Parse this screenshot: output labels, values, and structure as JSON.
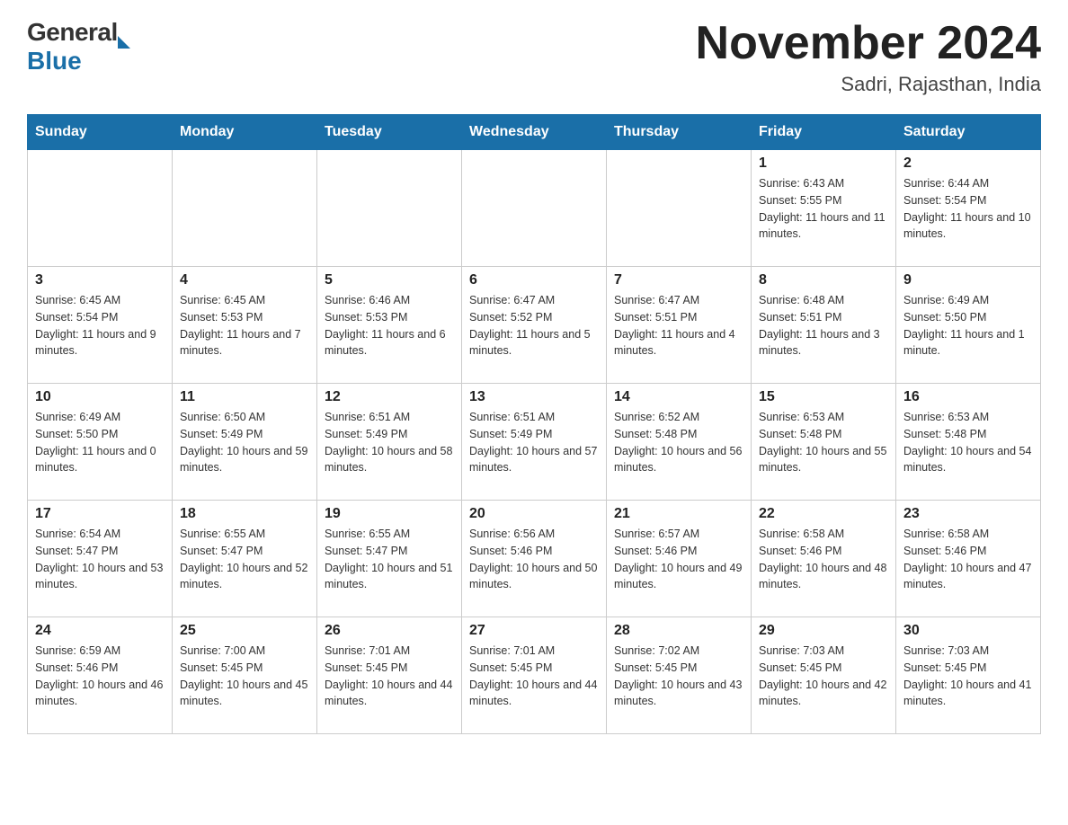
{
  "logo": {
    "general": "General",
    "arrow": "",
    "blue": "Blue"
  },
  "header": {
    "title": "November 2024",
    "subtitle": "Sadri, Rajasthan, India"
  },
  "days_of_week": [
    "Sunday",
    "Monday",
    "Tuesday",
    "Wednesday",
    "Thursday",
    "Friday",
    "Saturday"
  ],
  "weeks": [
    [
      {
        "day": "",
        "info": ""
      },
      {
        "day": "",
        "info": ""
      },
      {
        "day": "",
        "info": ""
      },
      {
        "day": "",
        "info": ""
      },
      {
        "day": "",
        "info": ""
      },
      {
        "day": "1",
        "info": "Sunrise: 6:43 AM\nSunset: 5:55 PM\nDaylight: 11 hours and 11 minutes."
      },
      {
        "day": "2",
        "info": "Sunrise: 6:44 AM\nSunset: 5:54 PM\nDaylight: 11 hours and 10 minutes."
      }
    ],
    [
      {
        "day": "3",
        "info": "Sunrise: 6:45 AM\nSunset: 5:54 PM\nDaylight: 11 hours and 9 minutes."
      },
      {
        "day": "4",
        "info": "Sunrise: 6:45 AM\nSunset: 5:53 PM\nDaylight: 11 hours and 7 minutes."
      },
      {
        "day": "5",
        "info": "Sunrise: 6:46 AM\nSunset: 5:53 PM\nDaylight: 11 hours and 6 minutes."
      },
      {
        "day": "6",
        "info": "Sunrise: 6:47 AM\nSunset: 5:52 PM\nDaylight: 11 hours and 5 minutes."
      },
      {
        "day": "7",
        "info": "Sunrise: 6:47 AM\nSunset: 5:51 PM\nDaylight: 11 hours and 4 minutes."
      },
      {
        "day": "8",
        "info": "Sunrise: 6:48 AM\nSunset: 5:51 PM\nDaylight: 11 hours and 3 minutes."
      },
      {
        "day": "9",
        "info": "Sunrise: 6:49 AM\nSunset: 5:50 PM\nDaylight: 11 hours and 1 minute."
      }
    ],
    [
      {
        "day": "10",
        "info": "Sunrise: 6:49 AM\nSunset: 5:50 PM\nDaylight: 11 hours and 0 minutes."
      },
      {
        "day": "11",
        "info": "Sunrise: 6:50 AM\nSunset: 5:49 PM\nDaylight: 10 hours and 59 minutes."
      },
      {
        "day": "12",
        "info": "Sunrise: 6:51 AM\nSunset: 5:49 PM\nDaylight: 10 hours and 58 minutes."
      },
      {
        "day": "13",
        "info": "Sunrise: 6:51 AM\nSunset: 5:49 PM\nDaylight: 10 hours and 57 minutes."
      },
      {
        "day": "14",
        "info": "Sunrise: 6:52 AM\nSunset: 5:48 PM\nDaylight: 10 hours and 56 minutes."
      },
      {
        "day": "15",
        "info": "Sunrise: 6:53 AM\nSunset: 5:48 PM\nDaylight: 10 hours and 55 minutes."
      },
      {
        "day": "16",
        "info": "Sunrise: 6:53 AM\nSunset: 5:48 PM\nDaylight: 10 hours and 54 minutes."
      }
    ],
    [
      {
        "day": "17",
        "info": "Sunrise: 6:54 AM\nSunset: 5:47 PM\nDaylight: 10 hours and 53 minutes."
      },
      {
        "day": "18",
        "info": "Sunrise: 6:55 AM\nSunset: 5:47 PM\nDaylight: 10 hours and 52 minutes."
      },
      {
        "day": "19",
        "info": "Sunrise: 6:55 AM\nSunset: 5:47 PM\nDaylight: 10 hours and 51 minutes."
      },
      {
        "day": "20",
        "info": "Sunrise: 6:56 AM\nSunset: 5:46 PM\nDaylight: 10 hours and 50 minutes."
      },
      {
        "day": "21",
        "info": "Sunrise: 6:57 AM\nSunset: 5:46 PM\nDaylight: 10 hours and 49 minutes."
      },
      {
        "day": "22",
        "info": "Sunrise: 6:58 AM\nSunset: 5:46 PM\nDaylight: 10 hours and 48 minutes."
      },
      {
        "day": "23",
        "info": "Sunrise: 6:58 AM\nSunset: 5:46 PM\nDaylight: 10 hours and 47 minutes."
      }
    ],
    [
      {
        "day": "24",
        "info": "Sunrise: 6:59 AM\nSunset: 5:46 PM\nDaylight: 10 hours and 46 minutes."
      },
      {
        "day": "25",
        "info": "Sunrise: 7:00 AM\nSunset: 5:45 PM\nDaylight: 10 hours and 45 minutes."
      },
      {
        "day": "26",
        "info": "Sunrise: 7:01 AM\nSunset: 5:45 PM\nDaylight: 10 hours and 44 minutes."
      },
      {
        "day": "27",
        "info": "Sunrise: 7:01 AM\nSunset: 5:45 PM\nDaylight: 10 hours and 44 minutes."
      },
      {
        "day": "28",
        "info": "Sunrise: 7:02 AM\nSunset: 5:45 PM\nDaylight: 10 hours and 43 minutes."
      },
      {
        "day": "29",
        "info": "Sunrise: 7:03 AM\nSunset: 5:45 PM\nDaylight: 10 hours and 42 minutes."
      },
      {
        "day": "30",
        "info": "Sunrise: 7:03 AM\nSunset: 5:45 PM\nDaylight: 10 hours and 41 minutes."
      }
    ]
  ]
}
